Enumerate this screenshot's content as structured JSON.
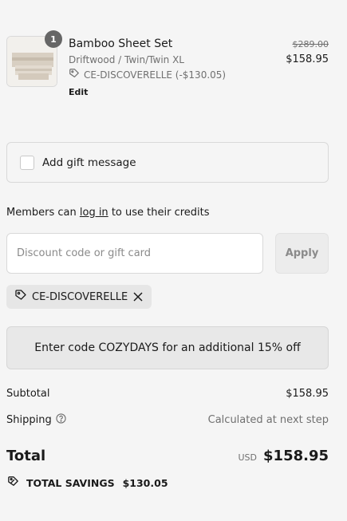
{
  "line_item": {
    "quantity": "1",
    "title": "Bamboo Sheet Set",
    "variant": "Driftwood / Twin/Twin XL",
    "discount_code": "CE-DISCOVERELLE (-$130.05)",
    "edit_label": "Edit",
    "original_price": "$289.00",
    "price": "$158.95"
  },
  "gift": {
    "label": "Add gift message",
    "checked": false
  },
  "members": {
    "prefix": "Members can ",
    "link": "log in",
    "suffix": " to use their credits"
  },
  "discount": {
    "placeholder": "Discount code or gift card",
    "value": "",
    "apply_label": "Apply",
    "applied_code": "CE-DISCOVERELLE"
  },
  "promo": {
    "text": "Enter code COZYDAYS for an additional 15% off"
  },
  "summary": {
    "subtotal_label": "Subtotal",
    "subtotal_value": "$158.95",
    "shipping_label": "Shipping",
    "shipping_value": "Calculated at next step",
    "total_label": "Total",
    "currency": "USD",
    "total_value": "$158.95",
    "savings_label": "TOTAL SAVINGS",
    "savings_value": "$130.05"
  },
  "colors": {
    "background": "#f5f5f5",
    "text": "#1a1a1a",
    "muted": "#707070",
    "badge": "#666666"
  },
  "icons": {
    "tag": "tag-icon",
    "close": "close-icon",
    "help": "help-circle-icon"
  }
}
